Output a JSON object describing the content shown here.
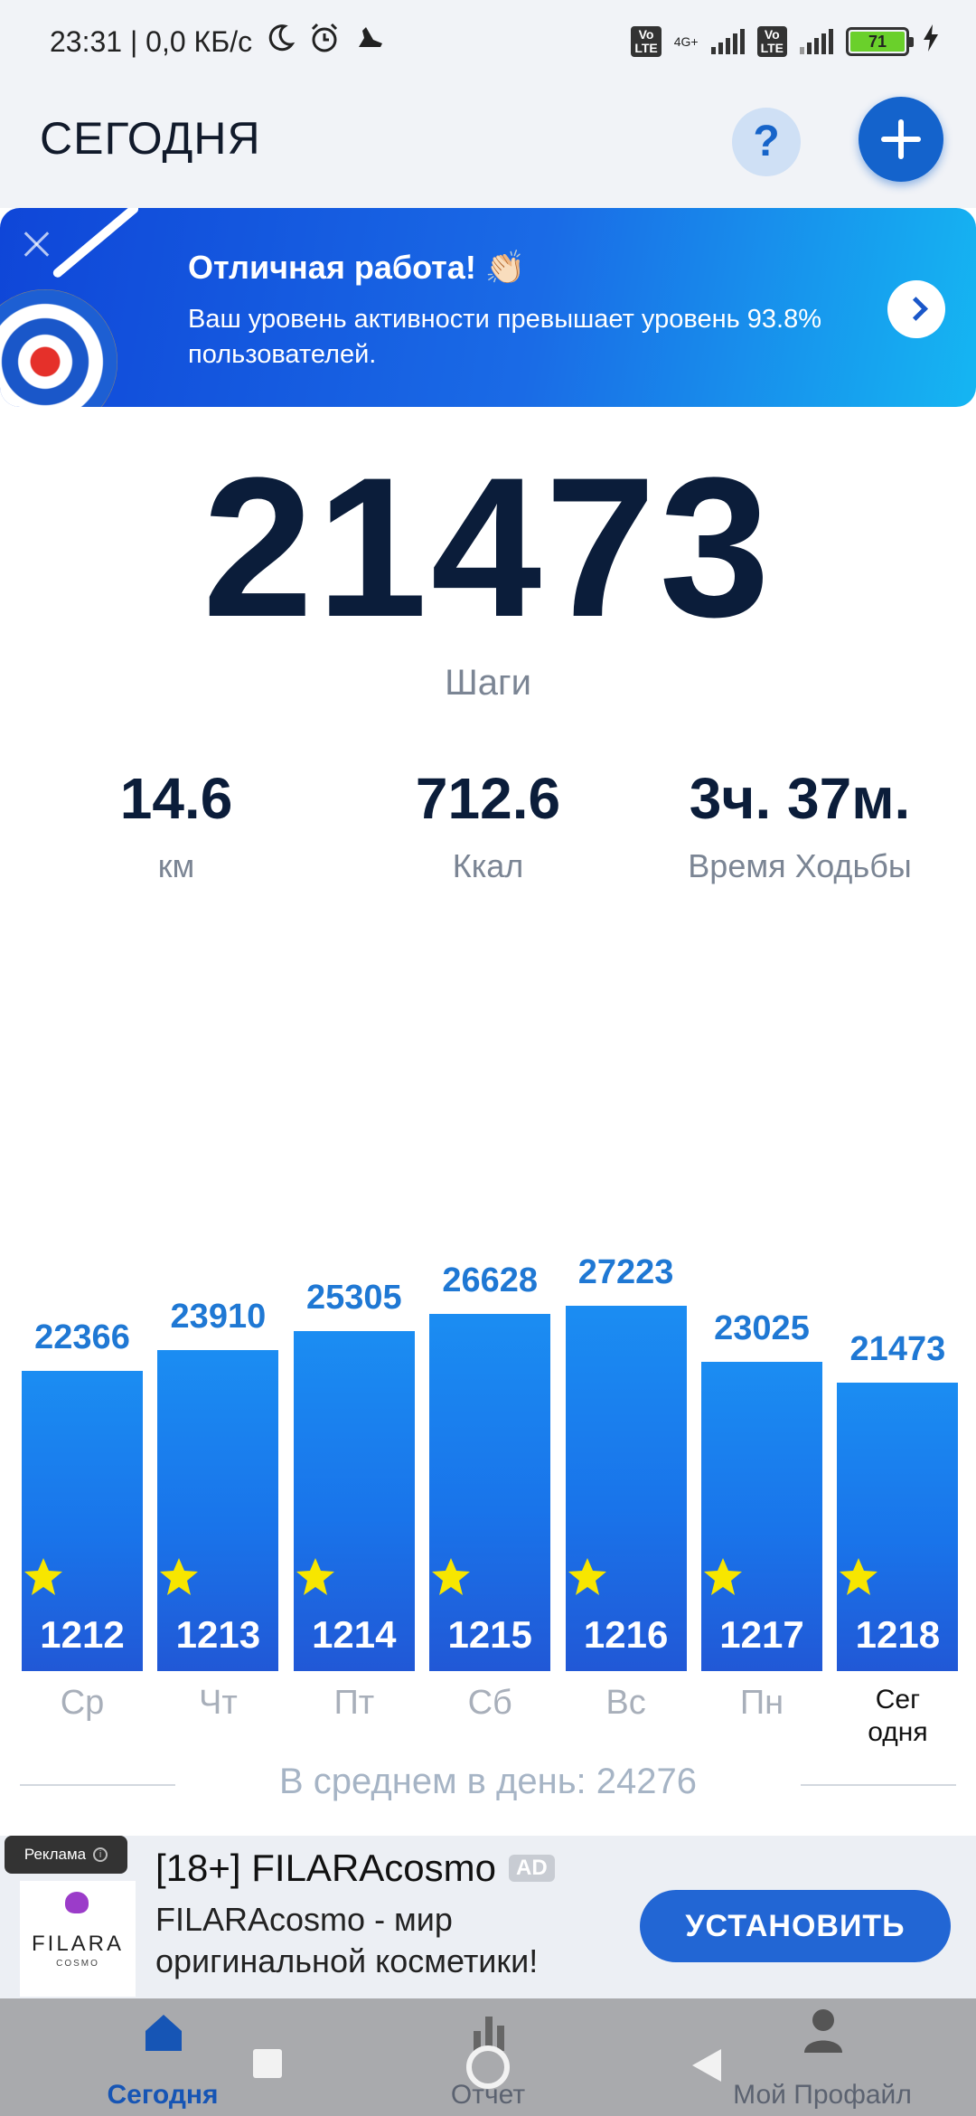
{
  "status_bar": {
    "time_speed": "23:31 | 0,0 КБ/с",
    "network_top": "4G+",
    "volte": "Vo LTE",
    "battery": "71"
  },
  "header": {
    "title": "СЕГОДНЯ",
    "help_label": "?"
  },
  "banner": {
    "title": "Отличная работа! 👏🏻",
    "text": "Ваш уровень активности превышает уровень 93.8% пользователей."
  },
  "summary": {
    "steps": "21473",
    "steps_label": "Шаги",
    "distance": "14.6",
    "distance_unit": "км",
    "calories": "712.6",
    "calories_unit": "Ккал",
    "time": "3ч. 37м.",
    "time_label": "Время Ходьбы"
  },
  "chart_data": {
    "type": "bar",
    "categories": [
      "Ср",
      "Чт",
      "Пт",
      "Сб",
      "Вс",
      "Пн",
      "Сег одня"
    ],
    "values": [
      22366,
      23910,
      25305,
      26628,
      27223,
      23025,
      21473
    ],
    "bar_ids": [
      "1212",
      "1213",
      "1214",
      "1215",
      "1216",
      "1217",
      "1218"
    ],
    "value_labels": [
      "22366",
      "23910",
      "25305",
      "26628",
      "27223",
      "23025",
      "21473"
    ],
    "day_labels": [
      "Ср",
      "Чт",
      "Пт",
      "Сб",
      "Вс",
      "Пн",
      "Сег\nодня"
    ],
    "highlight_last": true,
    "bar_color": "#1a7de9",
    "star_color": "#f7e600"
  },
  "average": {
    "text": "В среднем в день: 24276"
  },
  "ad": {
    "badge": "Реклама",
    "logo_text": "FILARA",
    "logo_sub": "COSMO",
    "title": "[18+] FILARAcosmo",
    "tag": "AD",
    "description": "FILARAcosmo - мир оригинальной косметики!",
    "button": "УСТАНОВИТЬ"
  },
  "nav": {
    "today": "Сегодня",
    "report": "Отчет",
    "profile": "Мой Профайл",
    "active_color": "#1655b5"
  }
}
